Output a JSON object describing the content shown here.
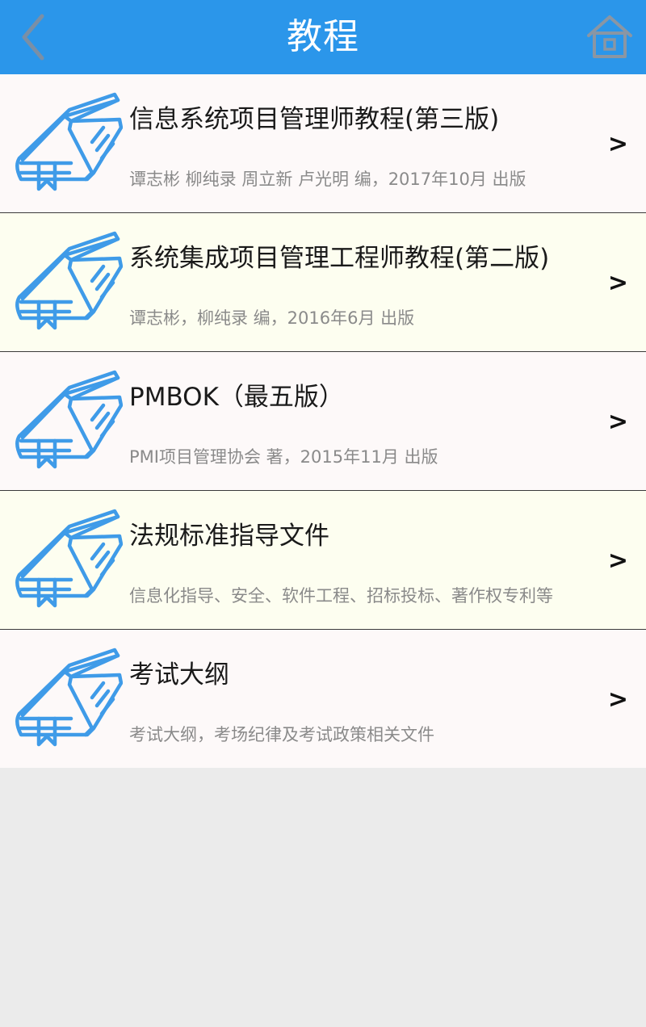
{
  "header": {
    "title": "教程",
    "back_icon": "chevron-left-icon",
    "home_icon": "home-icon"
  },
  "colors": {
    "header_bg": "#2b96ea",
    "icon_blue": "#3f9be8",
    "row_pink": "#fdf9f9",
    "row_cream": "#fdfef0",
    "page_bg": "#ebebeb"
  },
  "items": [
    {
      "title": "信息系统项目管理师教程(第三版)",
      "subtitle": "谭志彬 柳纯录 周立新 卢光明 编，2017年10月 出版",
      "chevron": ">"
    },
    {
      "title": "系统集成项目管理工程师教程(第二版)",
      "subtitle": "谭志彬，柳纯录 编，2016年6月 出版",
      "chevron": ">"
    },
    {
      "title": "PMBOK（最五版）",
      "subtitle": "PMI项目管理协会 著，2015年11月 出版",
      "chevron": ">"
    },
    {
      "title": "法规标准指导文件",
      "subtitle": "信息化指导、安全、软件工程、招标投标、著作权专利等",
      "chevron": ">"
    },
    {
      "title": "考试大纲",
      "subtitle": "考试大纲，考场纪律及考试政策相关文件",
      "chevron": ">"
    }
  ]
}
